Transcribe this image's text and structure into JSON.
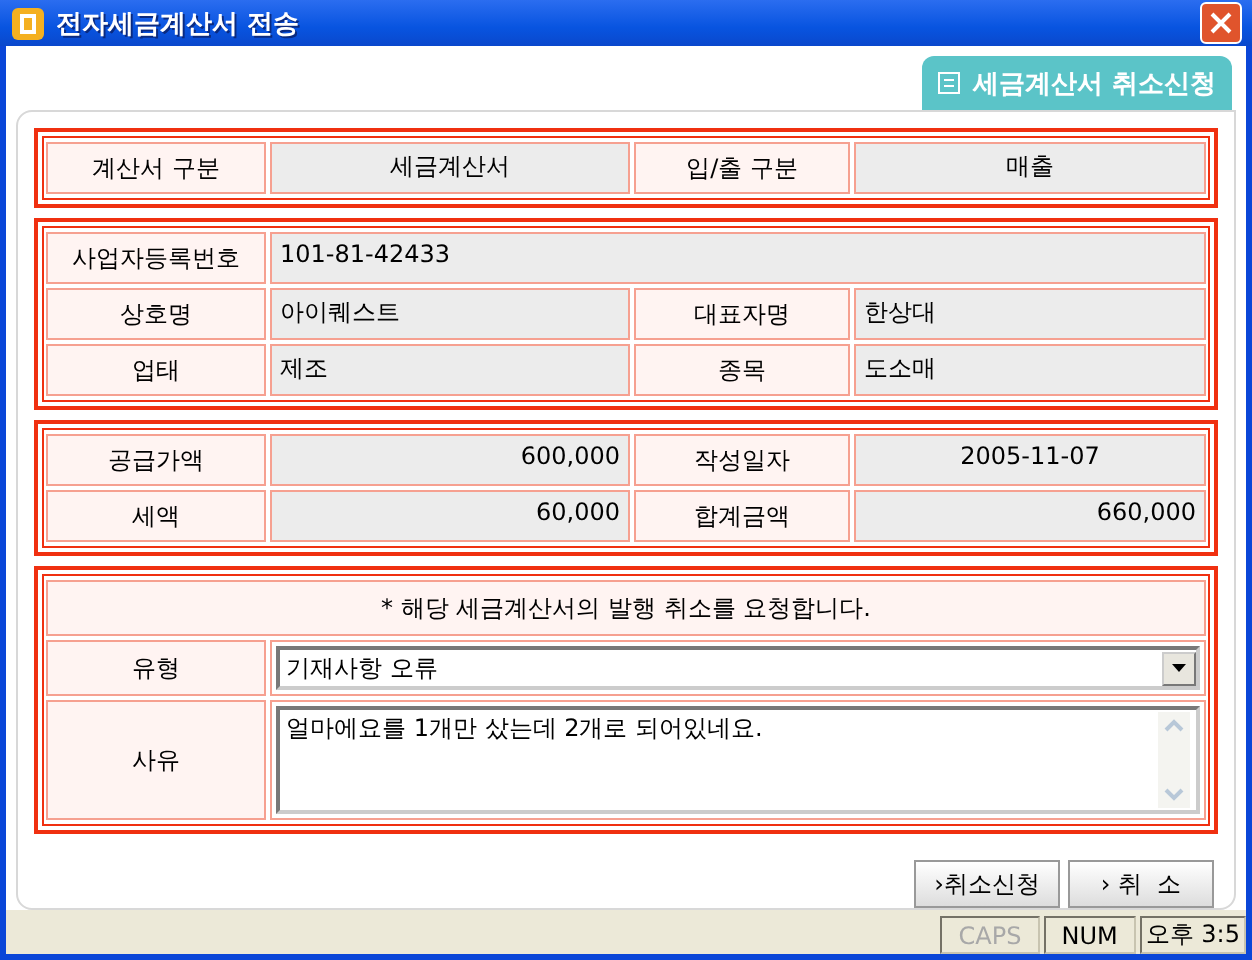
{
  "window": {
    "title": "전자세금계산서 전송"
  },
  "tab": {
    "label": "세금계산서 취소신청"
  },
  "sections": [
    {
      "rows": [
        [
          {
            "kind": "label",
            "text": "계산서 구분"
          },
          {
            "kind": "value",
            "text": "세금계산서"
          },
          {
            "kind": "label",
            "text": "입/출 구분"
          },
          {
            "kind": "value",
            "text": "매출"
          }
        ]
      ]
    },
    {
      "rows": [
        [
          {
            "kind": "label",
            "text": "사업자등록번호"
          },
          {
            "kind": "text",
            "text": "101-81-42433"
          }
        ],
        [
          {
            "kind": "label",
            "text": "상호명"
          },
          {
            "kind": "text",
            "text": "아이퀘스트"
          },
          {
            "kind": "label",
            "text": "대표자명"
          },
          {
            "kind": "text",
            "text": "한상대"
          }
        ],
        [
          {
            "kind": "label",
            "text": "업태"
          },
          {
            "kind": "text",
            "text": "제조"
          },
          {
            "kind": "label",
            "text": "종목"
          },
          {
            "kind": "text",
            "text": "도소매"
          }
        ]
      ]
    },
    {
      "rows": [
        [
          {
            "kind": "label",
            "text": "공급가액"
          },
          {
            "kind": "number",
            "text": "600,000"
          },
          {
            "kind": "label",
            "text": "작성일자"
          },
          {
            "kind": "value",
            "text": "2005-11-07"
          }
        ],
        [
          {
            "kind": "label",
            "text": "세액"
          },
          {
            "kind": "number",
            "text": "60,000"
          },
          {
            "kind": "label",
            "text": "합계금액"
          },
          {
            "kind": "number",
            "text": "660,000"
          }
        ]
      ]
    }
  ],
  "request": {
    "notice": "* 해당 세금계산서의 발행 취소를 요청합니다.",
    "type_label": "유형",
    "type_value": "기재사항 오류",
    "reason_label": "사유",
    "reason_value": "얼마에요를 1개만 샀는데 2개로 되어있네요."
  },
  "buttons": [
    {
      "label": "›취소신청"
    },
    {
      "label": "› 취  소"
    }
  ],
  "status_bar": [
    {
      "text": "CAPS",
      "disabled": true
    },
    {
      "text": "NUM",
      "disabled": false
    },
    {
      "text": "오후 3:5"
    }
  ]
}
